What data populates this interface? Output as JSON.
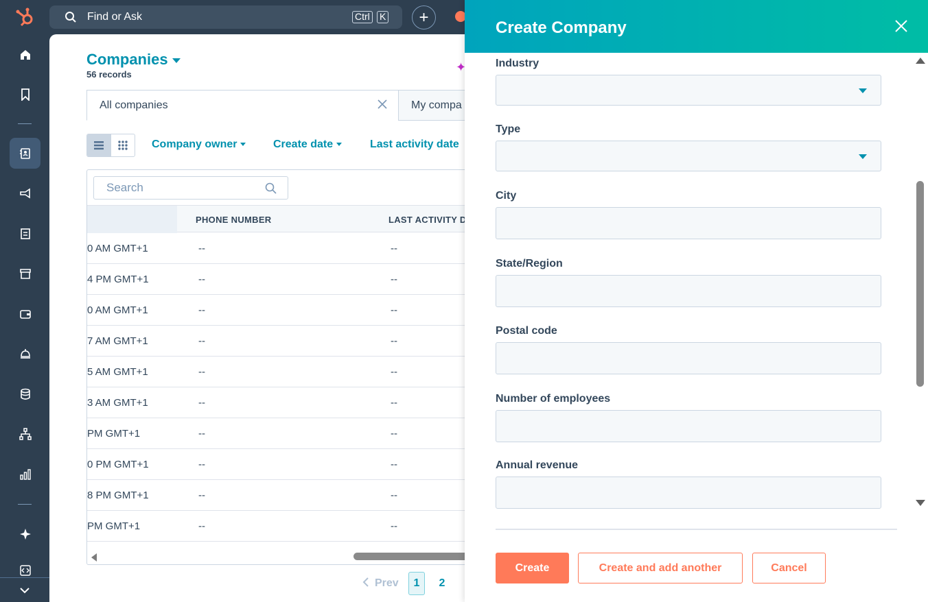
{
  "topbar": {
    "search_placeholder": "Find or Ask",
    "shortcut_key1": "Ctrl",
    "shortcut_key2": "K",
    "add_symbol": "+"
  },
  "page": {
    "title": "Companies",
    "record_count": "56 records"
  },
  "views": {
    "active_tab": "All companies",
    "second_tab": "My compa"
  },
  "filters": {
    "owner": "Company owner",
    "create_date": "Create date",
    "last_activity": "Last activity date"
  },
  "table": {
    "search_placeholder": "Search",
    "headers": [
      "PHONE NUMBER",
      "LAST ACTIVITY D"
    ],
    "rows": [
      {
        "date": "0 AM GMT+1",
        "phone": "--",
        "activity": "--"
      },
      {
        "date": "4 PM GMT+1",
        "phone": "--",
        "activity": "--"
      },
      {
        "date": "0 AM GMT+1",
        "phone": "--",
        "activity": "--"
      },
      {
        "date": "7 AM GMT+1",
        "phone": "--",
        "activity": "--"
      },
      {
        "date": "5 AM GMT+1",
        "phone": "--",
        "activity": "--"
      },
      {
        "date": "3 AM GMT+1",
        "phone": "--",
        "activity": "--"
      },
      {
        "date": "PM GMT+1",
        "phone": "--",
        "activity": "--"
      },
      {
        "date": "0 PM GMT+1",
        "phone": "--",
        "activity": "--"
      },
      {
        "date": "8 PM GMT+1",
        "phone": "--",
        "activity": "--"
      },
      {
        "date": "PM GMT+1",
        "phone": "--",
        "activity": "--"
      }
    ]
  },
  "pagination": {
    "prev": "Prev",
    "pages": [
      "1",
      "2"
    ],
    "current": "1"
  },
  "panel": {
    "title": "Create Company",
    "fields": [
      {
        "label": "Industry",
        "type": "dropdown",
        "value": ""
      },
      {
        "label": "Type",
        "type": "dropdown",
        "value": ""
      },
      {
        "label": "City",
        "type": "text",
        "value": ""
      },
      {
        "label": "State/Region",
        "type": "text",
        "value": ""
      },
      {
        "label": "Postal code",
        "type": "text",
        "value": ""
      },
      {
        "label": "Number of employees",
        "type": "text",
        "value": ""
      },
      {
        "label": "Annual revenue",
        "type": "text",
        "value": ""
      }
    ],
    "create_label": "Create",
    "create_another_label": "Create and add another",
    "cancel_label": "Cancel"
  },
  "colors": {
    "nav_bg": "#2e3f50",
    "accent": "#0091ae",
    "primary_button": "#ff7a59",
    "header_gradient_start": "#00a4bd",
    "header_gradient_end": "#00bda5"
  }
}
